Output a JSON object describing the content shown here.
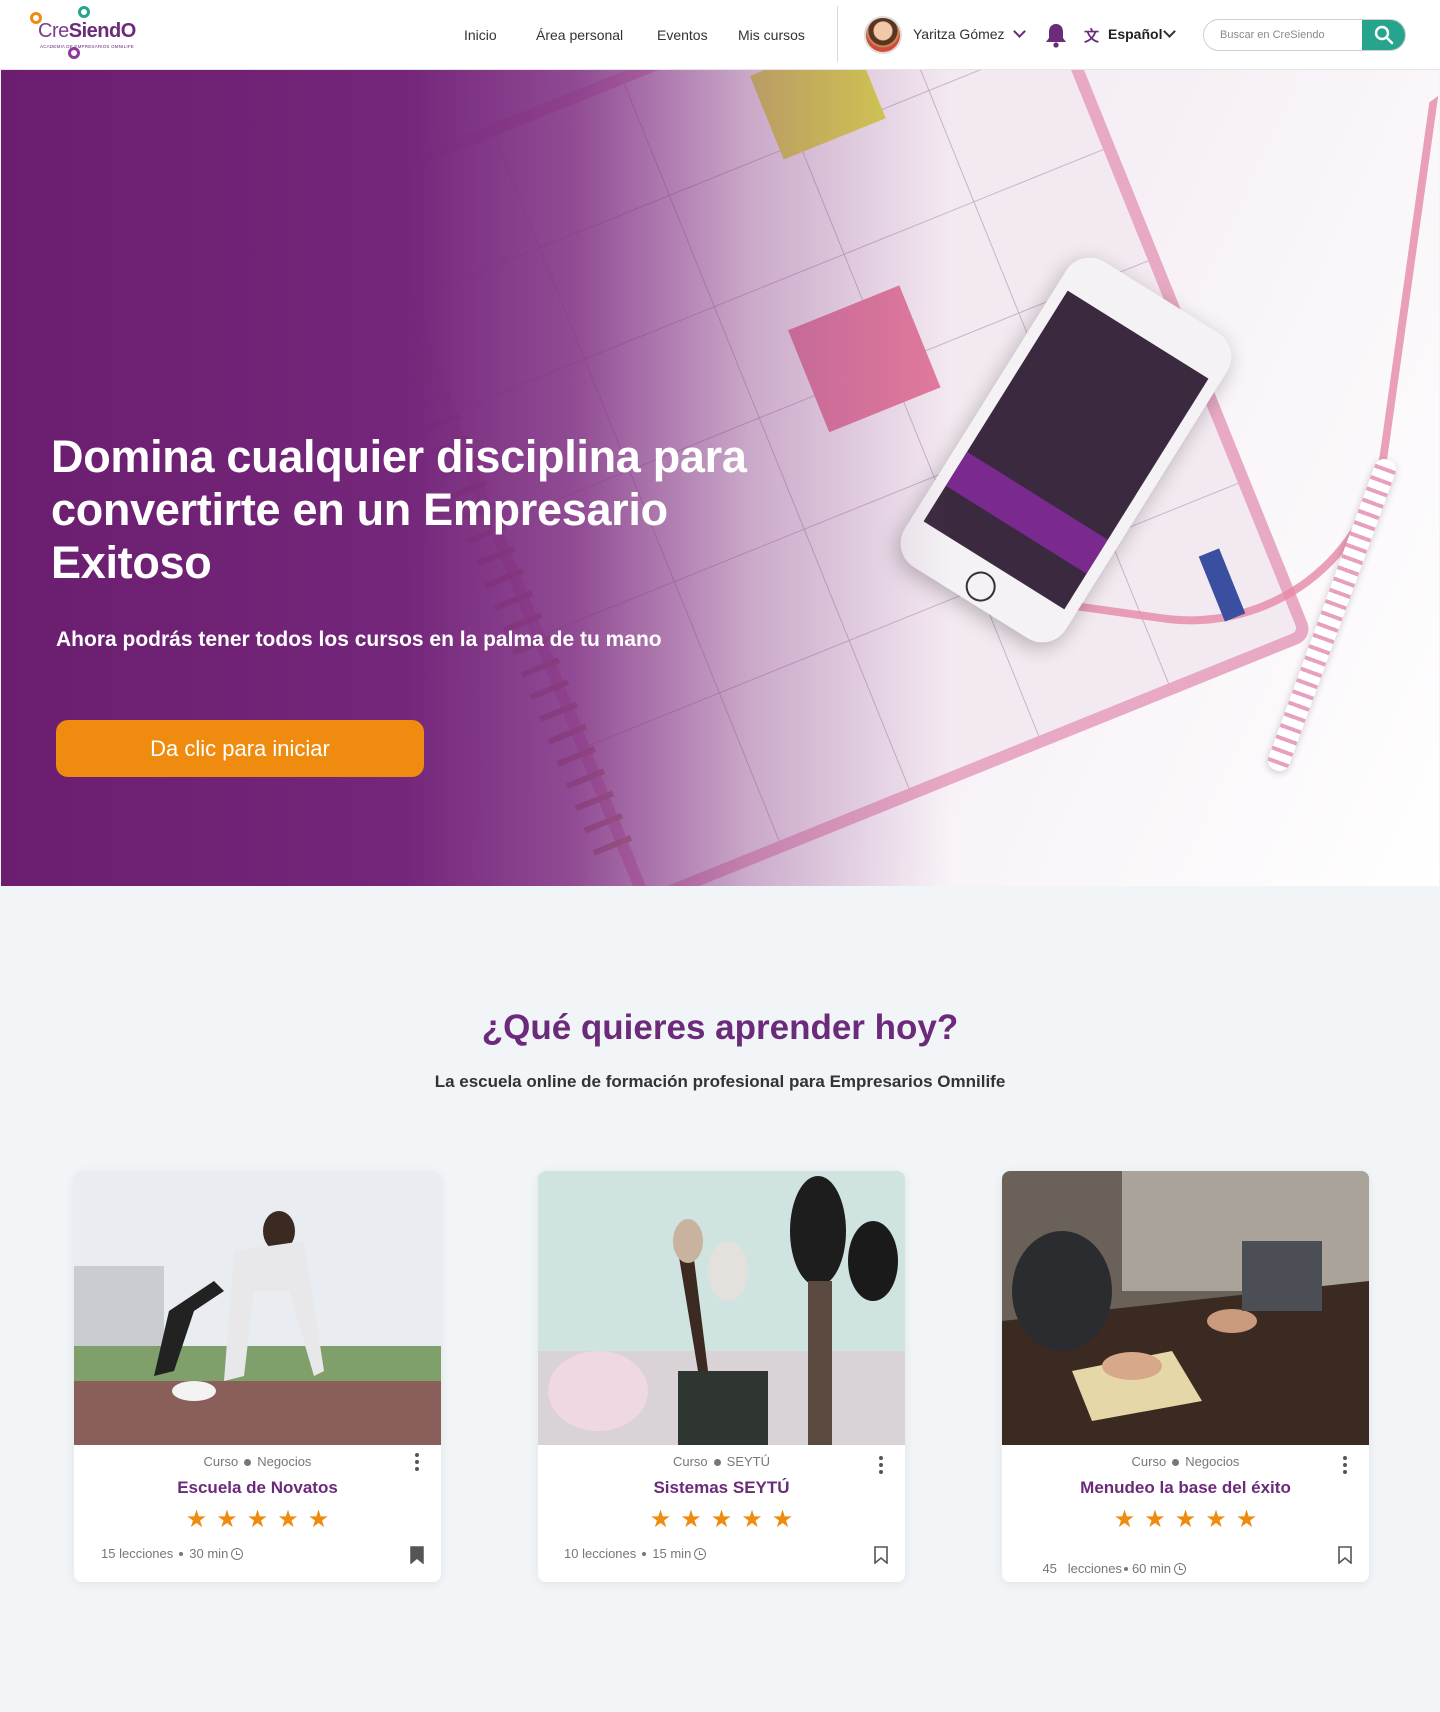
{
  "brand": {
    "logo_text_a": "Cre",
    "logo_text_b": "SiendO",
    "logo_subtitle": "ACADEMIA DE EMPRESARIOS OMNILIFE",
    "colors": {
      "purple": "#6b2a7a",
      "teal": "#27a58c",
      "orange": "#ef8c10"
    }
  },
  "nav": {
    "items": [
      {
        "label": "Inicio"
      },
      {
        "label": "Área personal"
      },
      {
        "label": "Eventos"
      },
      {
        "label": "Mis cursos"
      }
    ]
  },
  "user": {
    "name": "Yaritza Gómez"
  },
  "language": {
    "label": "Español",
    "icon": "translate-icon"
  },
  "search": {
    "placeholder": "Buscar en CreSiendo",
    "icon": "search-icon"
  },
  "hero": {
    "title": "Domina cualquier disciplina para convertirte en un Empresario Exitoso",
    "subtitle": "Ahora podrás tener todos los cursos en la palma de tu mano",
    "cta": "Da clic para iniciar"
  },
  "section": {
    "title": "¿Qué quieres aprender hoy?",
    "subtitle": "La escuela online de formación profesional para Empresarios Omnilife"
  },
  "courses": [
    {
      "type": "Curso",
      "category": "Negocios",
      "title": "Escuela de Novatos",
      "stars": 5,
      "lessons": "15 lecciones",
      "duration": "30 min",
      "bookmarked": true
    },
    {
      "type": "Curso",
      "category": "SEYTÚ",
      "title": "Sistemas SEYTÚ",
      "stars": 5,
      "lessons": "10 lecciones",
      "duration": "15 min",
      "bookmarked": false
    },
    {
      "type": "Curso",
      "category": "Negocios",
      "title": "Menudeo la base del éxito",
      "stars": 5,
      "lessons": "45   lecciones",
      "duration": "60 min",
      "bookmarked": false
    }
  ]
}
